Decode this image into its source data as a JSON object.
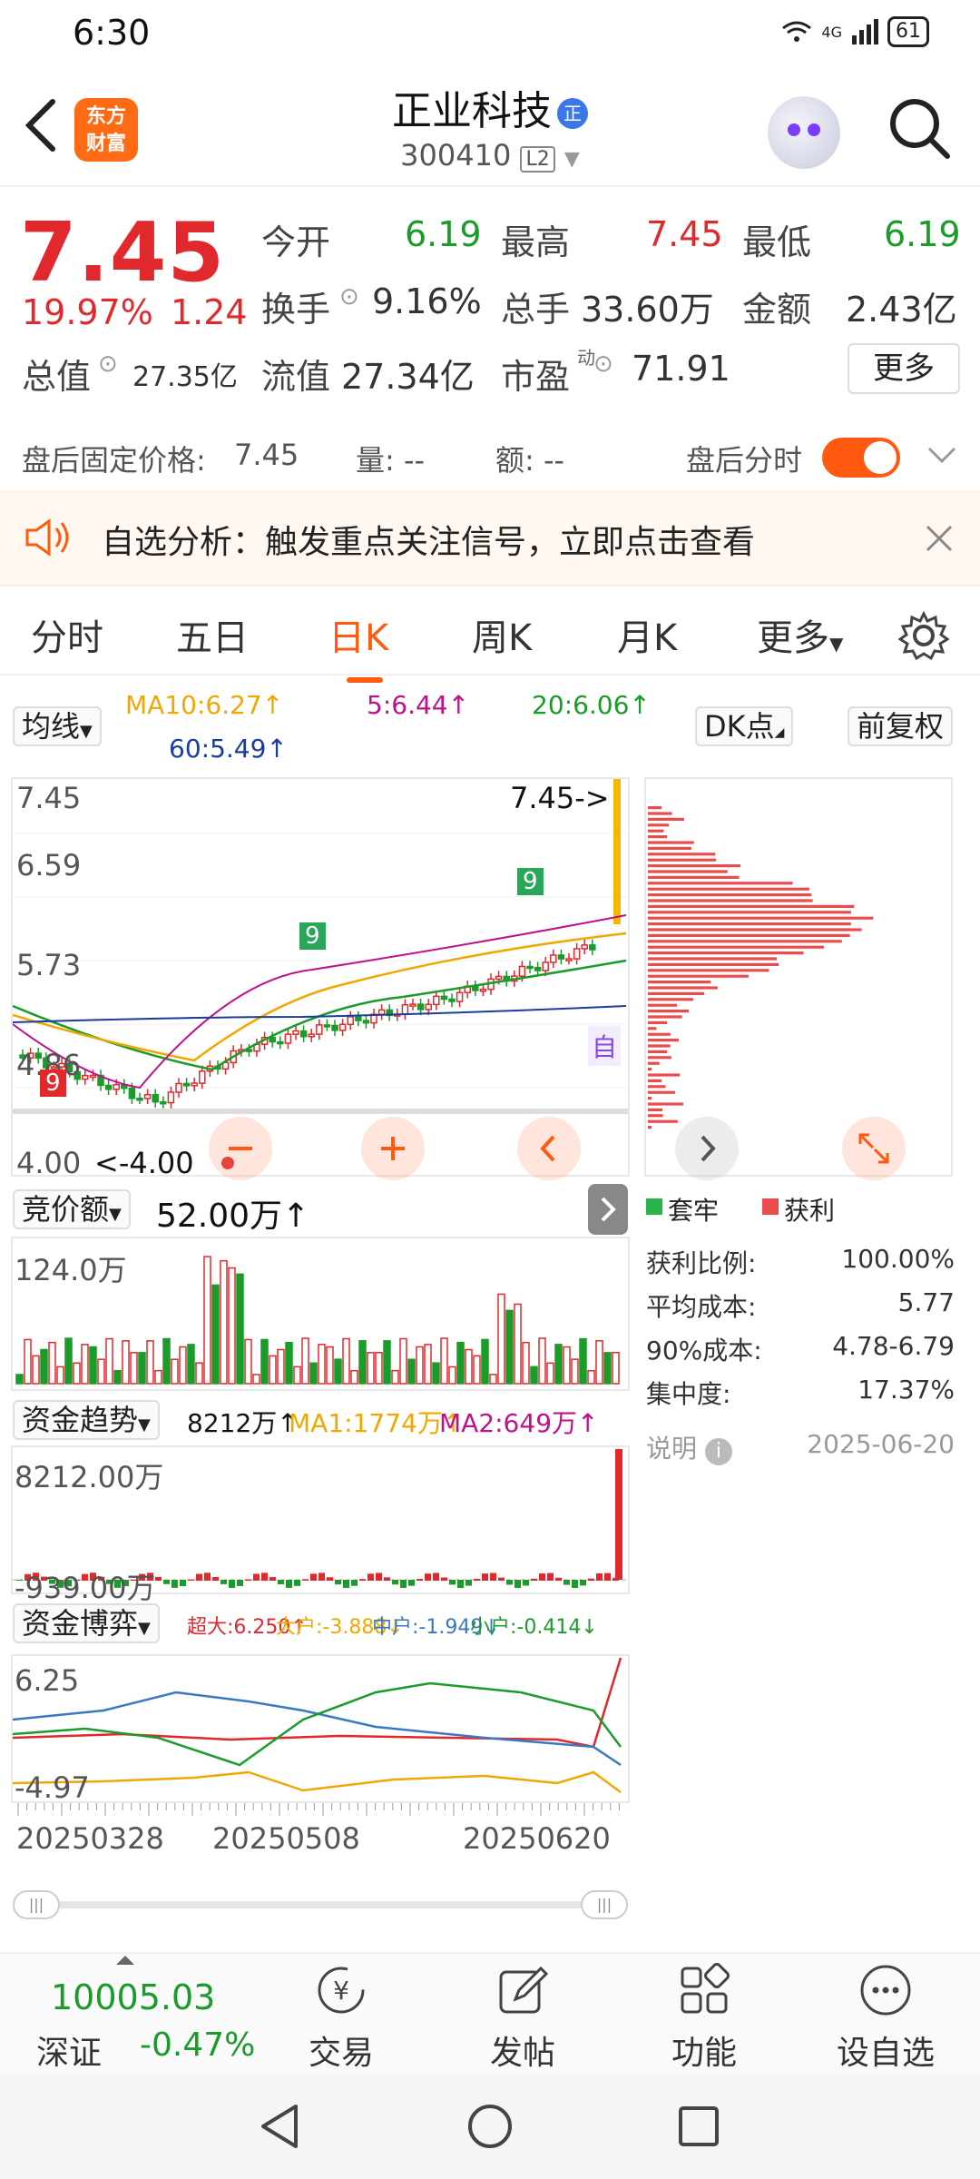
{
  "status": {
    "time": "6:30",
    "network": "4G",
    "battery": "61"
  },
  "header": {
    "logo_line1": "东方",
    "logo_line2": "财富",
    "stock_name": "正业科技",
    "name_tag": "正",
    "stock_code": "300410",
    "level": "L2"
  },
  "quote": {
    "price": "7.45",
    "change_pct": "19.97%",
    "change": "1.24",
    "open_label": "今开",
    "open": "6.19",
    "high_label": "最高",
    "high": "7.45",
    "low_label": "最低",
    "low": "6.19",
    "turnover_label": "换手",
    "turnover": "9.16%",
    "volume_label": "总手",
    "volume": "33.60万",
    "amount_label": "金额",
    "amount": "2.43亿",
    "mktcap_label": "总值",
    "mktcap": "27.35亿",
    "float_label": "流值",
    "float": "27.34亿",
    "pe_label": "市盈",
    "pe_sup": "动",
    "pe": "71.91",
    "more": "更多"
  },
  "after_hours": {
    "price_label": "盘后固定价格:",
    "price": "7.45",
    "vol": "量: --",
    "amt": "额: --",
    "timeshare": "盘后分时"
  },
  "notice": {
    "text": "自选分析：触发重点关注信号，立即点击查看"
  },
  "tabs": [
    "分时",
    "五日",
    "日K",
    "周K",
    "月K",
    "更多"
  ],
  "ma": {
    "selector": "均线",
    "ma10": "MA10:6.27↑",
    "ma5": "5:6.44↑",
    "ma20": "20:6.06↑",
    "ma60": "60:5.49↑",
    "dk": "DK点",
    "adjust": "前复权"
  },
  "kchart": {
    "y_labels": [
      "7.45",
      "6.59",
      "5.73",
      "4.86",
      "4.00"
    ],
    "last_tag": "7.45->",
    "low_tag": "<-4.00",
    "zi": "自",
    "seq_badge": "9"
  },
  "volume": {
    "selector": "竞价额",
    "value": "52.00万↑",
    "max_label": "124.0万"
  },
  "capital": {
    "selector": "资金趋势",
    "value": "8212万↑",
    "ma1": "MA1:1774万↑",
    "ma2": "MA2:649万↑",
    "max_label": "8212.00万",
    "min_label": "-939.00万"
  },
  "game": {
    "selector": "资金博弈",
    "super": "超大:6.250↑",
    "big": "大户:-3.888↓",
    "mid": "中户:-1.949↓",
    "small": "小户:-0.414↓",
    "max_label": "6.25",
    "min_label": "-4.97"
  },
  "dates": [
    "20250328",
    "20250508",
    "20250620"
  ],
  "chip": {
    "legend_trap": "套牢",
    "legend_profit": "获利",
    "rows": [
      {
        "label": "获利比例:",
        "value": "100.00%"
      },
      {
        "label": "平均成本:",
        "value": "5.77"
      },
      {
        "label": "90%成本:",
        "value": "4.78-6.79"
      },
      {
        "label": "集中度:",
        "value": "17.37%"
      }
    ],
    "note": "说明",
    "date": "2025-06-20"
  },
  "index": {
    "value": "10005.03",
    "name": "深证",
    "pct": "-0.47%"
  },
  "bottom_nav": [
    "交易",
    "发帖",
    "功能",
    "设自选"
  ],
  "colors": {
    "up": "#e0282d",
    "down": "#1a9b2a",
    "accent": "#ff5a10"
  }
}
